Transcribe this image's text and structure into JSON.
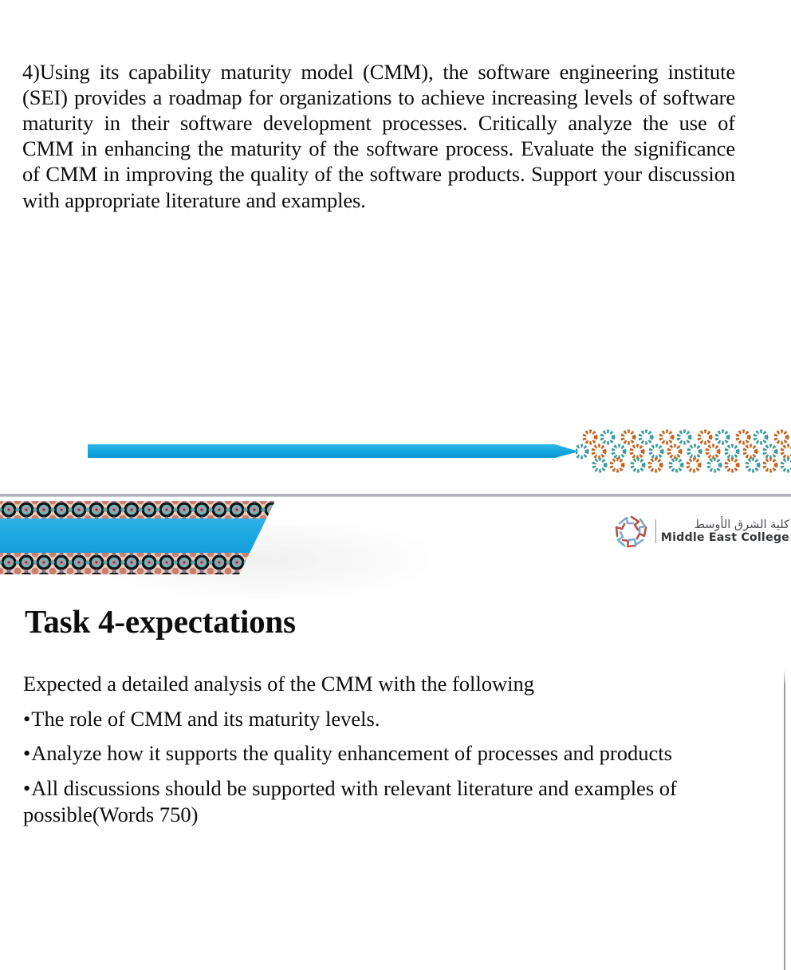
{
  "document": {
    "type": "presentation-slides",
    "slide_count": 2
  },
  "colors": {
    "accent_blue": "#1CA8E2",
    "accent_blue_dark": "#0F8FC6",
    "ornament_teal": "#3C9C9C",
    "ornament_orange": "#C8631E",
    "logo_red": "#B4544B",
    "logo_blue": "#7FA8C9",
    "divider_gray": "#A9ACB1",
    "text_black": "#0D0D0D"
  },
  "slide_one": {
    "body_text": "4)Using its capability maturity model (CMM), the software engineering institute (SEI) provides a roadmap for organizations to achieve increasing levels of software maturity in their software development processes. Critically analyze the use of CMM in enhancing the maturity of the software process. Evaluate the significance of CMM in improving the quality of the software products. Support your discussion with appropriate literature and examples.",
    "decor": {
      "blue_bar": "tapered-blue-bar",
      "ornament": "rosette-pattern-band"
    }
  },
  "slide_two": {
    "banner": {
      "name": "decorative-header-banner",
      "pattern": "mosaic-ornament-strip",
      "band_color": "#1CA8E2"
    },
    "logo": {
      "mark": "pinwheel-emblem",
      "arabic_name": "كلية الشرق الأوسط",
      "english_name": "Middle East College"
    },
    "title": "Task 4-expectations",
    "content_lines": [
      {
        "text": "Expected a detailed analysis of the CMM with the following",
        "bullet": false
      },
      {
        "text": "The role of CMM and its maturity levels.",
        "bullet": true
      },
      {
        "text": "Analyze how it supports the quality enhancement of processes and products",
        "bullet": true
      },
      {
        "text": "All discussions should be supported with relevant literature and examples of possible(Words  750)",
        "bullet": true
      }
    ]
  }
}
